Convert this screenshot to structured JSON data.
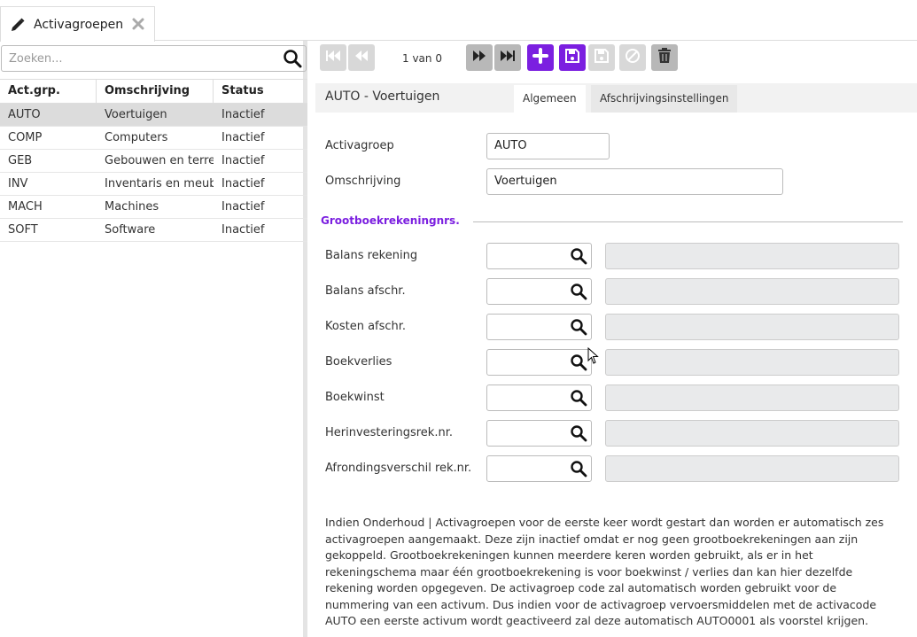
{
  "tabs": [
    {
      "label": "Activagroepen",
      "icon": "pencil-icon",
      "close_icon": "close-icon"
    }
  ],
  "list": {
    "search_placeholder": "Zoeken...",
    "columns": [
      "Act.grp.",
      "Omschrijving",
      "Status"
    ],
    "rows": [
      {
        "code": "AUTO",
        "desc": "Voertuigen",
        "status": "Inactief"
      },
      {
        "code": "COMP",
        "desc": "Computers",
        "status": "Inactief"
      },
      {
        "code": "GEB",
        "desc": "Gebouwen en terre",
        "status": "Inactief"
      },
      {
        "code": "INV",
        "desc": "Inventaris en meub",
        "status": "Inactief"
      },
      {
        "code": "MACH",
        "desc": "Machines",
        "status": "Inactief"
      },
      {
        "code": "SOFT",
        "desc": "Software",
        "status": "Inactief"
      }
    ],
    "selected_index": 0
  },
  "toolbar": {
    "pager": "1 van 0",
    "buttons": [
      "first-icon",
      "previous-icon",
      "next-icon",
      "last-icon",
      "plus-icon",
      "save-icon",
      "save-disabled-icon",
      "cancel-icon",
      "trash-icon"
    ]
  },
  "form": {
    "title": "AUTO - Voertuigen",
    "tabs": [
      "Algemeen",
      "Afschrijvingsinstellingen"
    ],
    "active_tab": 0,
    "fields": {
      "activagroep": {
        "label": "Activagroep",
        "value": "AUTO"
      },
      "omschrijving": {
        "label": "Omschrijving",
        "value": "Voertuigen"
      }
    },
    "section_title": "Grootboekrekeningnrs.",
    "ledger_fields": [
      {
        "label": "Balans rekening"
      },
      {
        "label": "Balans afschr."
      },
      {
        "label": "Kosten afschr."
      },
      {
        "label": "Boekverlies"
      },
      {
        "label": "Boekwinst"
      },
      {
        "label": "Herinvesteringsrek.nr."
      },
      {
        "label": "Afrondingsverschil rek.nr."
      }
    ],
    "info_text": "Indien Onderhoud | Activagroepen voor de eerste keer wordt gestart dan worden er automatisch zes activagroepen aangemaakt. Deze zijn inactief omdat er nog geen grootboekrekeningen aan zijn gekoppeld. Grootboekrekeningen kunnen meerdere keren worden gebruikt, als er in het rekeningschema maar één grootboekrekening is voor boekwinst / verlies dan kan hier dezelfde rekening worden opgegeven. De activagroep code zal automatisch worden gebruikt voor de nummering van een activum. Dus indien voor de activagroep vervoersmiddelen met de activacode AUTO een eerste activum wordt geactiveerd zal deze automatisch AUTO0001 als voorstel krijgen."
  },
  "colors": {
    "accent": "#7b1fe0",
    "selected_row": "#dcdcdc",
    "readonly": "#e9eaeb"
  }
}
